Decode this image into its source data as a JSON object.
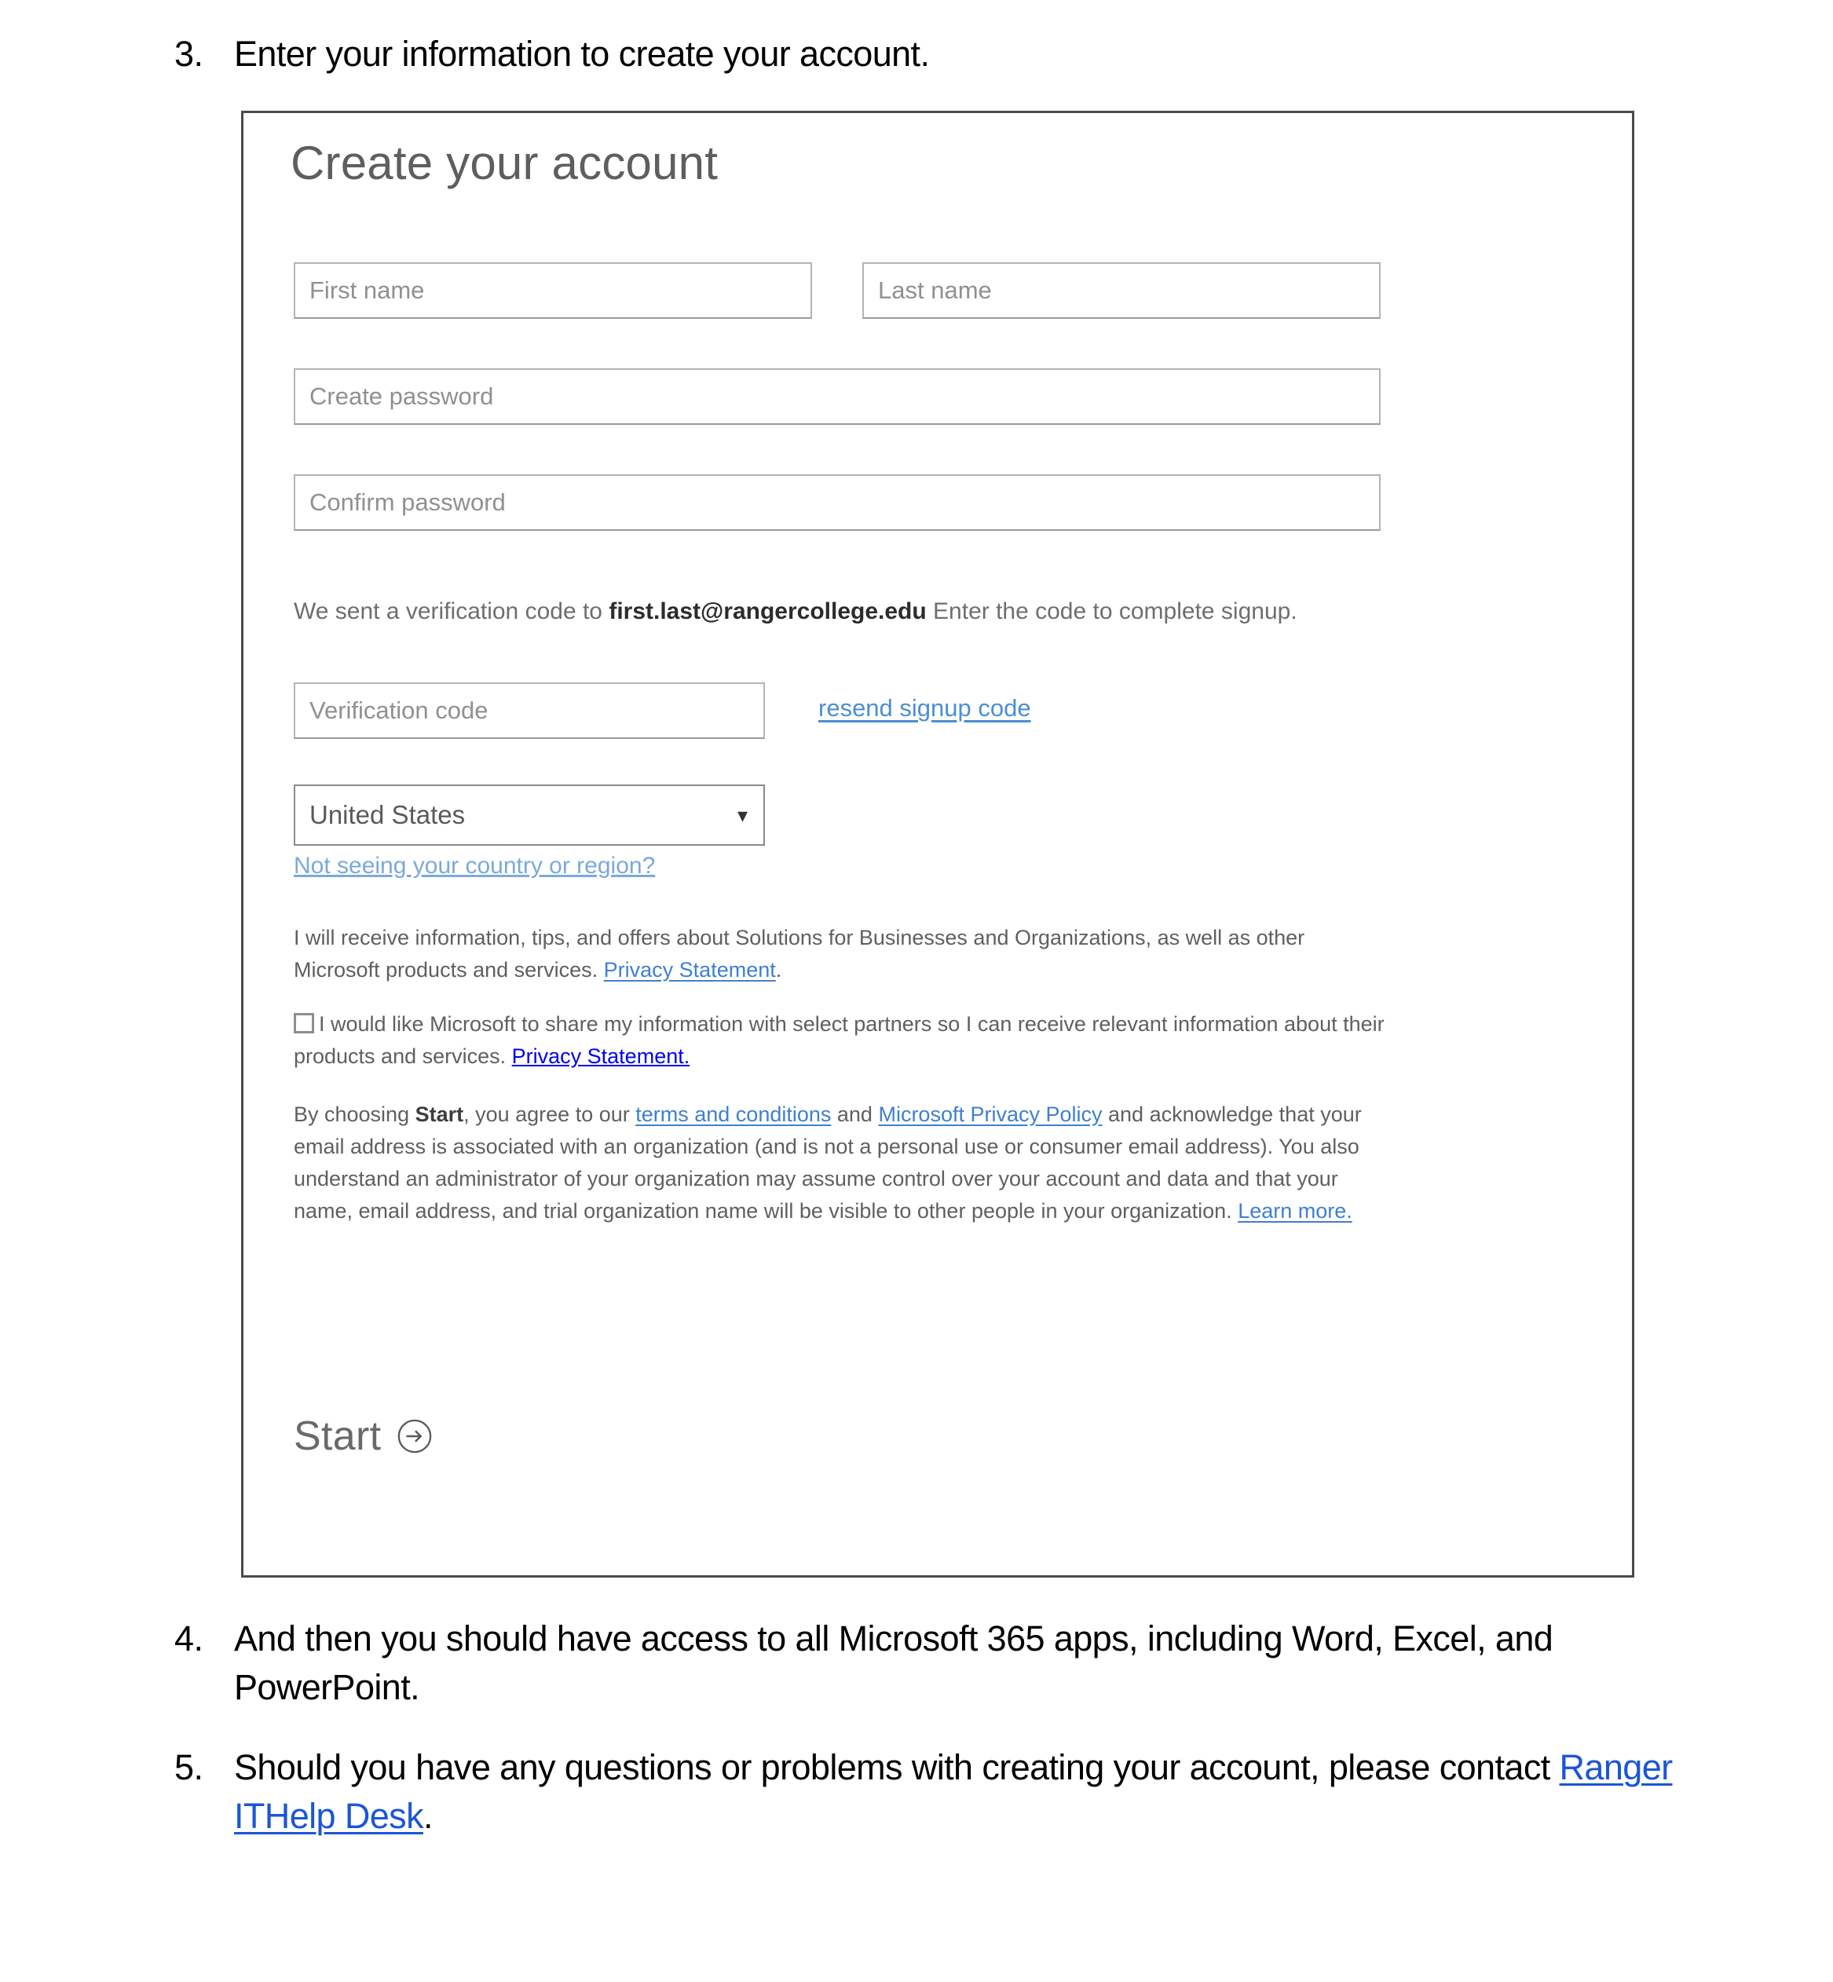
{
  "document": {
    "steps": [
      {
        "number": "3.",
        "text": "Enter your information to create your account."
      },
      {
        "number": "4.",
        "text": "And then you should have access to all Microsoft 365 apps, including Word, Excel, and PowerPoint."
      },
      {
        "number": "5.",
        "text_before": "Should you have any questions or problems with creating your account, please contact ",
        "link": "Ranger ITHelp Desk",
        "text_after": "."
      }
    ]
  },
  "screenshot": {
    "title": "Create your account",
    "fields": {
      "first_name_placeholder": "First name",
      "last_name_placeholder": "Last name",
      "create_password_placeholder": "Create password",
      "confirm_password_placeholder": "Confirm password",
      "verification_code_placeholder": "Verification code"
    },
    "verification": {
      "text_before": "We sent a verification code to  ",
      "email": "first.last@rangercollege.edu",
      "text_after": "   Enter the code to complete signup.",
      "resend_link": "resend signup code"
    },
    "country": {
      "selected": "United States",
      "chevron": "chevron-down",
      "not_seeing_link": "Not seeing your country or region?"
    },
    "consent": {
      "offers_text": "I will receive information, tips, and offers about Solutions for Businesses and Organizations, as well as other Microsoft products and services. ",
      "offers_link": "Privacy Statement",
      "offers_text_end": ".",
      "partners_text": "I would like Microsoft to share my information with select partners so I can receive relevant information about their products and services. ",
      "partners_link": "Privacy Statement.",
      "terms_part1": "By choosing ",
      "terms_bold": "Start",
      "terms_part2": ", you agree to our ",
      "terms_link1": "terms and conditions",
      "terms_part3": " and ",
      "terms_link2": "Microsoft Privacy Policy",
      "terms_part4": " and acknowledge that your email address is associated with an organization (and is not a personal use or consumer email address). You also understand an administrator of your organization may assume control over your account and data and that your name, email address, and trial organization name will be visible to other people in your organization. ",
      "terms_link3": "Learn more."
    },
    "start_button": {
      "label": "Start",
      "icon": "arrow-right-circle-icon"
    },
    "colors": {
      "link_blue": "#3f7fd0",
      "doc_link_blue": "#1a56d6",
      "placeholder_gray": "#909090",
      "title_gray": "#605e5c",
      "frame_border": "#4a4a4a"
    }
  }
}
